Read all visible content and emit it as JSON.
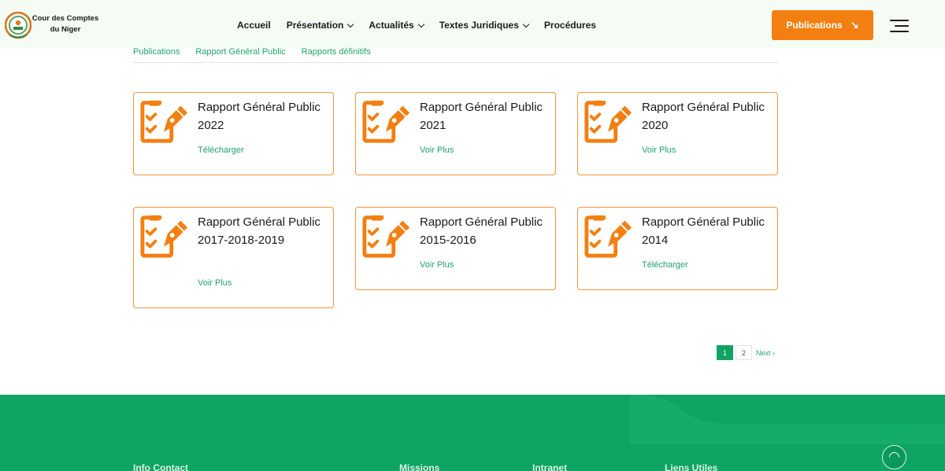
{
  "header": {
    "logo_text": "Cour des Comptes du Niger",
    "nav": [
      {
        "label": "Accueil",
        "dropdown": false
      },
      {
        "label": "Présentation",
        "dropdown": true
      },
      {
        "label": "Actualités",
        "dropdown": true
      },
      {
        "label": "Textes Juridiques",
        "dropdown": true
      },
      {
        "label": "Procédures",
        "dropdown": false
      }
    ],
    "publications_button": "Publications",
    "publications_button_icon": "arrow-down-right-icon",
    "menu_icon": "hamburger-menu-icon"
  },
  "breadcrumbs": [
    "Publications",
    "Rapport Général Public",
    "Rapports définitifs"
  ],
  "cards": [
    {
      "title": "Rapport Général Public 2022",
      "link": "Télécharger",
      "icon": "document-pen-icon"
    },
    {
      "title": "Rapport Général Public 2021",
      "link": "Voir Plus",
      "icon": "document-pen-icon"
    },
    {
      "title": "Rapport Général Public 2020",
      "link": "Voir Plus",
      "icon": "document-pen-icon"
    },
    {
      "title": "Rapport Général Public 2017-2018-2019",
      "link": "Voir Plus",
      "icon": "document-pen-icon"
    },
    {
      "title": "Rapport Général Public 2015-2016",
      "link": "Voir Plus",
      "icon": "document-pen-icon"
    },
    {
      "title": "Rapport Général Public 2014",
      "link": "Télécharger",
      "icon": "document-pen-icon"
    }
  ],
  "pagination": {
    "pages": [
      "1",
      "2"
    ],
    "current": "1",
    "next": "Next ›"
  },
  "footer": {
    "columns": [
      "Info Contact",
      "Missions",
      "Intranet",
      "Liens Utiles"
    ],
    "scroll_top_icon": "scroll-to-top-icon"
  },
  "colors": {
    "accent_orange": "#f47f11",
    "brand_green": "#10a364",
    "link_green": "#22a26c",
    "header_bg": "#f4fcf3"
  }
}
